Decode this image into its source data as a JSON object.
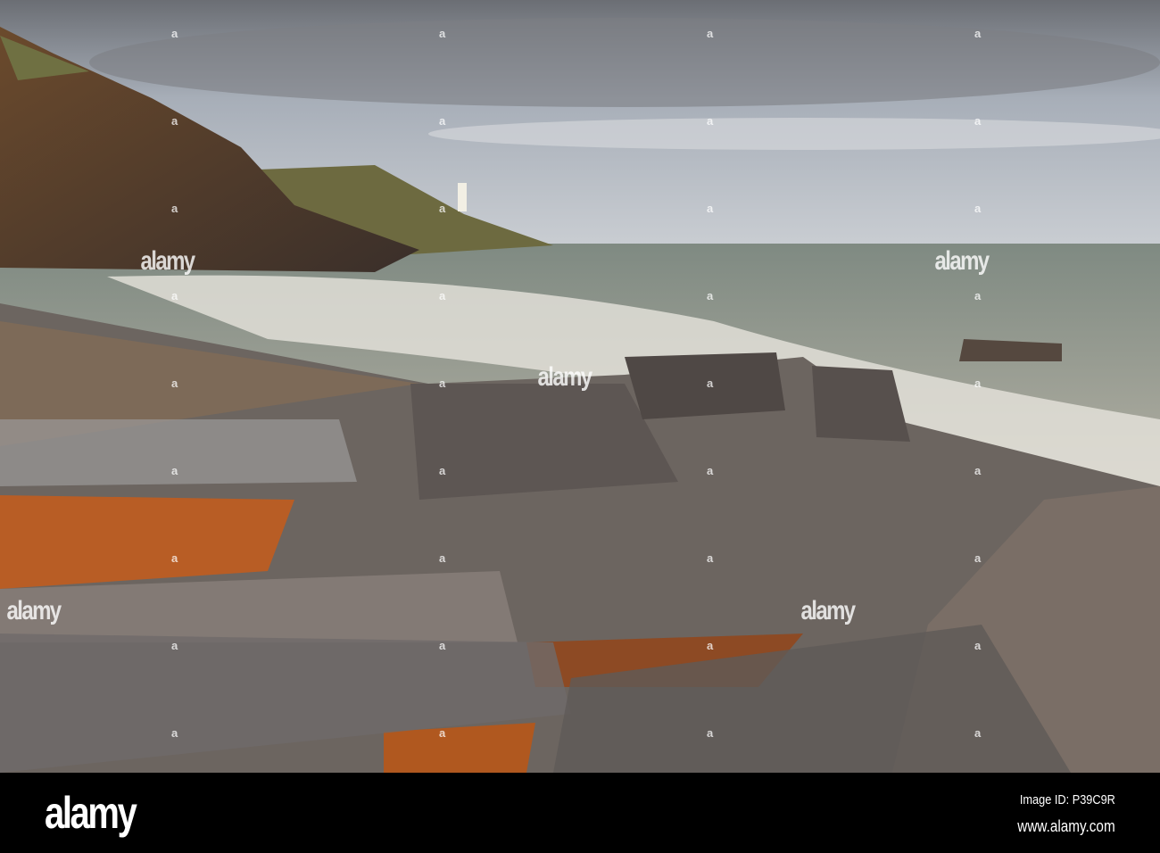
{
  "photo": {
    "subject": "Rocky coastline with lighthouse under cloudy sky"
  },
  "watermark": {
    "text": "alamy",
    "marks": "a"
  },
  "footer": {
    "logo": "alamy",
    "image_id": "Image ID: P39C9R",
    "url": "www.alamy.com"
  },
  "colors": {
    "sky": "#9ea6b0",
    "sea": "#8a9384",
    "rock": "#5a5450",
    "sand": "#c0642a"
  }
}
